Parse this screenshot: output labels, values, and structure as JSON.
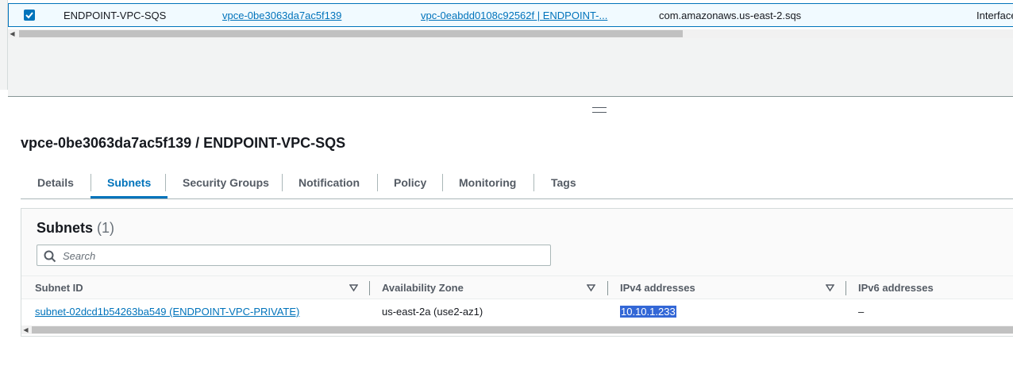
{
  "top_table": {
    "row": {
      "checked": true,
      "name": "ENDPOINT-VPC-SQS",
      "endpoint_id": "vpce-0be3063da7ac5f139",
      "vpc": "vpc-0eabdd0108c92562f | ENDPOINT-...",
      "service_name": "com.amazonaws.us-east-2.sqs",
      "type": "Interface"
    }
  },
  "detail": {
    "title": "vpce-0be3063da7ac5f139 / ENDPOINT-VPC-SQS",
    "tabs": [
      {
        "label": "Details",
        "active": false
      },
      {
        "label": "Subnets",
        "active": true
      },
      {
        "label": "Security Groups",
        "active": false
      },
      {
        "label": "Notification",
        "active": false
      },
      {
        "label": "Policy",
        "active": false
      },
      {
        "label": "Monitoring",
        "active": false
      },
      {
        "label": "Tags",
        "active": false
      }
    ]
  },
  "subnets": {
    "title": "Subnets",
    "count": "(1)",
    "search_placeholder": "Search",
    "columns": [
      "Subnet ID",
      "Availability Zone",
      "IPv4 addresses",
      "IPv6 addresses"
    ],
    "rows": [
      {
        "subnet_id": "subnet-02dcd1b54263ba549 (ENDPOINT-VPC-PRIVATE)",
        "availability_zone": "us-east-2a (use2-az1)",
        "ipv4": "10.10.1.233",
        "ipv6": "–"
      }
    ]
  },
  "colors": {
    "accent": "#0073bb",
    "selection": "#3367d6"
  }
}
